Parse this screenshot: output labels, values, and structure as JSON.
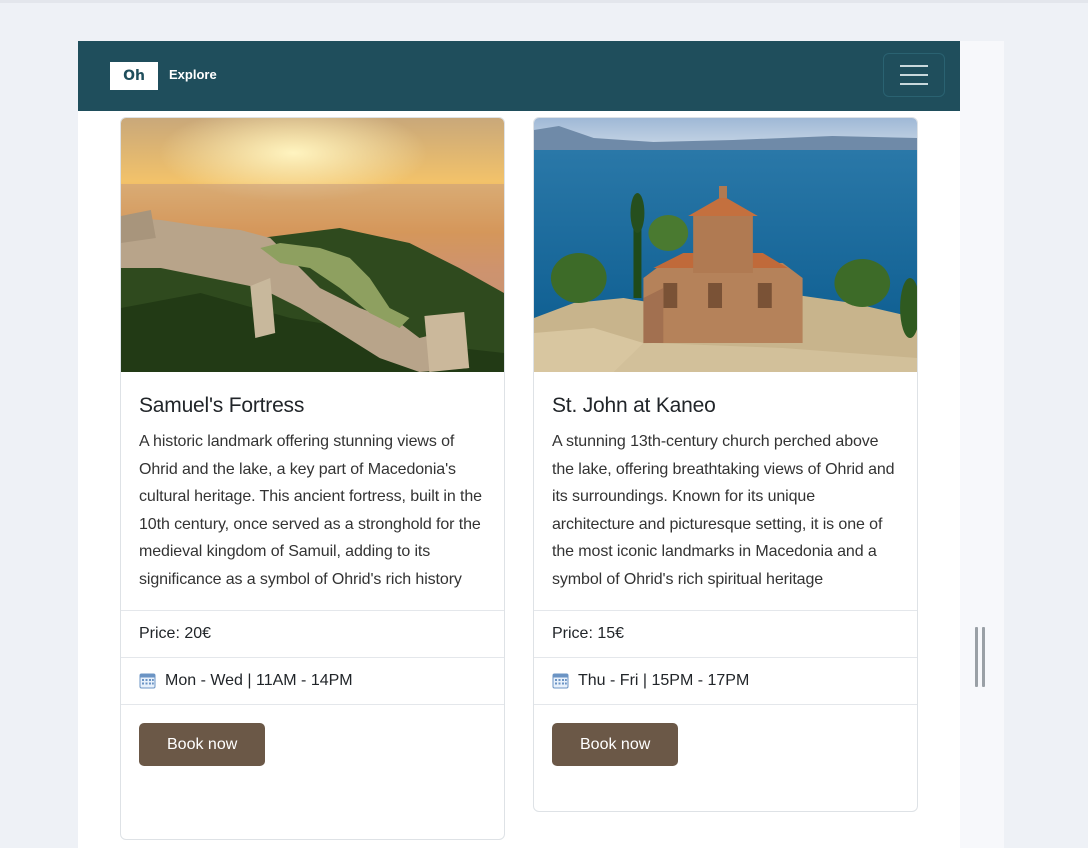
{
  "navbar": {
    "brand_logo": "Oh",
    "brand_text": "Explore"
  },
  "cards": [
    {
      "title": "Samuel's Fortress",
      "description": "A historic landmark offering stunning views of Ohrid and the lake, a key part of Macedonia's cultural heritage. This ancient fortress, built in the 10th century, once served as a stronghold for the medieval kingdom of Samuil, adding to its significance as a symbol of Ohrid's rich history",
      "price": "Price: 20€",
      "schedule": "Mon - Wed | 11AM - 14PM",
      "button": "Book now"
    },
    {
      "title": "St. John at Kaneo",
      "description": "A stunning 13th-century church perched above the lake, offering breathtaking views of Ohrid and its surroundings. Known for its unique architecture and picturesque setting, it is one of the most iconic landmarks in Macedonia and a symbol of Ohrid's rich spiritual heritage",
      "price": "Price: 15€",
      "schedule": "Thu - Fri | 15PM - 17PM",
      "button": "Book now"
    }
  ],
  "colors": {
    "navbar": "#1f4e5c",
    "button": "#6b5847",
    "background": "#eef1f6"
  },
  "icons": {
    "calendar": "calendar-icon",
    "menu": "hamburger-menu-icon"
  }
}
